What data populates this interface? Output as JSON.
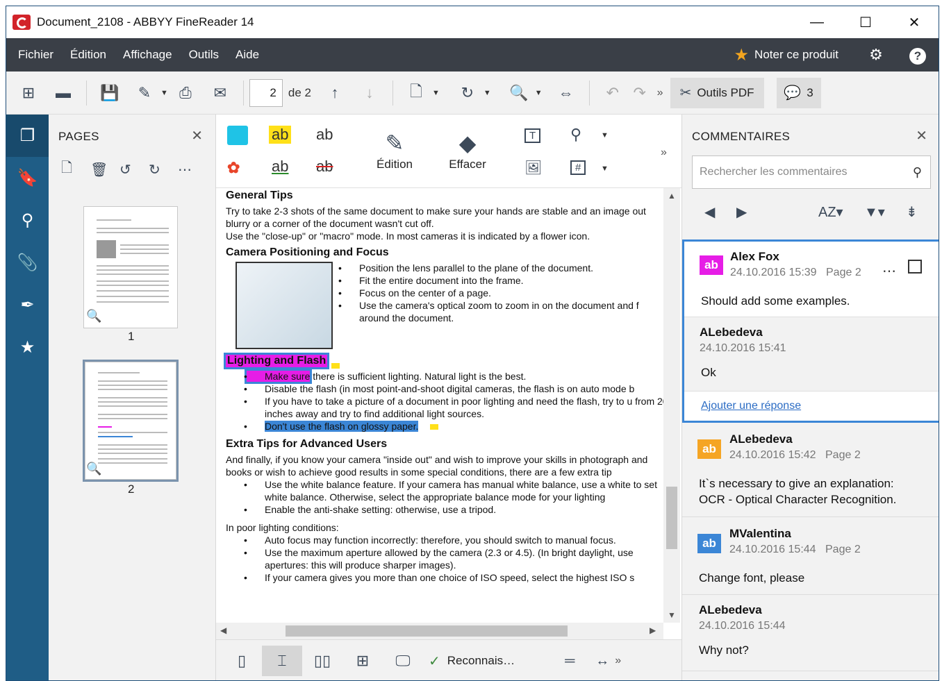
{
  "window": {
    "title": "Document_2108 - ABBYY FineReader 14",
    "minimize": "—",
    "maximize": "☐",
    "close": "✕"
  },
  "menu": {
    "items": [
      "Fichier",
      "Édition",
      "Affichage",
      "Outils",
      "Aide"
    ],
    "rate_label": "Noter ce produit"
  },
  "toolbar": {
    "current_page": "2",
    "page_of": "de 2",
    "more": "»",
    "pdf_tools_label": "Outils PDF",
    "comments_count": "3"
  },
  "pages_panel": {
    "title": "PAGES",
    "pages": [
      {
        "number": "1"
      },
      {
        "number": "2"
      }
    ]
  },
  "doc_toolbar": {
    "edit_label": "Édition",
    "erase_label": "Effacer",
    "more": "»"
  },
  "document": {
    "h1": "General Tips",
    "p1": "Try to take 2-3 shots of the same document to make sure your hands are stable and an image out blurry or a corner of the document wasn't cut off.",
    "p2": "Use the \"close-up\" or \"macro\" mode. In most cameras it is indicated by a flower icon.",
    "h2": "Camera Positioning and Focus",
    "cam_bullets": [
      "Position the lens parallel to the plane of the document.",
      "Fit the entire document into the frame.",
      "Focus on the center of a page.",
      "Use the camera's optical zoom to zoom in on the document and f around the document."
    ],
    "h3": "Lighting and Flash",
    "light_b1_hl": "Make sure",
    "light_b1_rest": " there is sufficient lighting. Natural light is the best.",
    "light_b2": "Disable the flash (in most point-and-shoot digital cameras, the flash is on auto mode b",
    "light_b3": "If you have to take a picture of a document in poor lighting and need the flash, try to u from 20 inches away and try to find additional light sources.",
    "light_b4": "Don't use the flash on glossy paper.",
    "h4": "Extra Tips for Advanced Users",
    "p3": "And finally, if you know your camera \"inside out\" and wish to improve your skills in photograph and books or wish to achieve good results in some special conditions, there are a few extra tip",
    "adv_bullets": [
      "Use the white balance feature. If your camera has manual white balance, use a white to set white balance. Otherwise, select the appropriate balance mode for your lighting",
      "Enable the anti-shake setting: otherwise, use a tripod."
    ],
    "p4": "In poor lighting conditions:",
    "poor_bullets": [
      "Auto focus may function incorrectly: therefore, you should switch to manual focus.",
      "Use the maximum aperture allowed by the camera (2.3 or 4.5). (In bright daylight, use apertures: this will produce sharper images).",
      "If your camera gives you more than one choice of ISO speed, select the highest ISO s"
    ]
  },
  "status": {
    "recognize_label": "Reconnais…",
    "more": "»"
  },
  "comments_panel": {
    "title": "COMMENTAIRES",
    "search_placeholder": "Rechercher les commentaires",
    "reply_label": "Ajouter une réponse",
    "comments": [
      {
        "author": "Alex Fox",
        "date": "24.10.2016 15:39",
        "page": "Page 2",
        "text": "Should add some examples.",
        "badge": "ab",
        "badge_color": "#e61de6"
      },
      {
        "author": "ALebedeva",
        "date": "24.10.2016 15:41",
        "text": "Ok"
      },
      {
        "author": "ALebedeva",
        "date": "24.10.2016 15:42",
        "page": "Page 2",
        "text1": "It`s necessary to give an explanation:",
        "text2": "OCR - Optical Character Recognition.",
        "badge": "ab",
        "badge_color": "#f5a524"
      },
      {
        "author": "MValentina",
        "date": "24.10.2016 15:44",
        "page": "Page 2",
        "text": "Change font, please",
        "badge": "ab",
        "badge_color": "#3b86d6"
      },
      {
        "author": "ALebedeva",
        "date": "24.10.2016 15:44",
        "text": "Why not?"
      }
    ]
  }
}
